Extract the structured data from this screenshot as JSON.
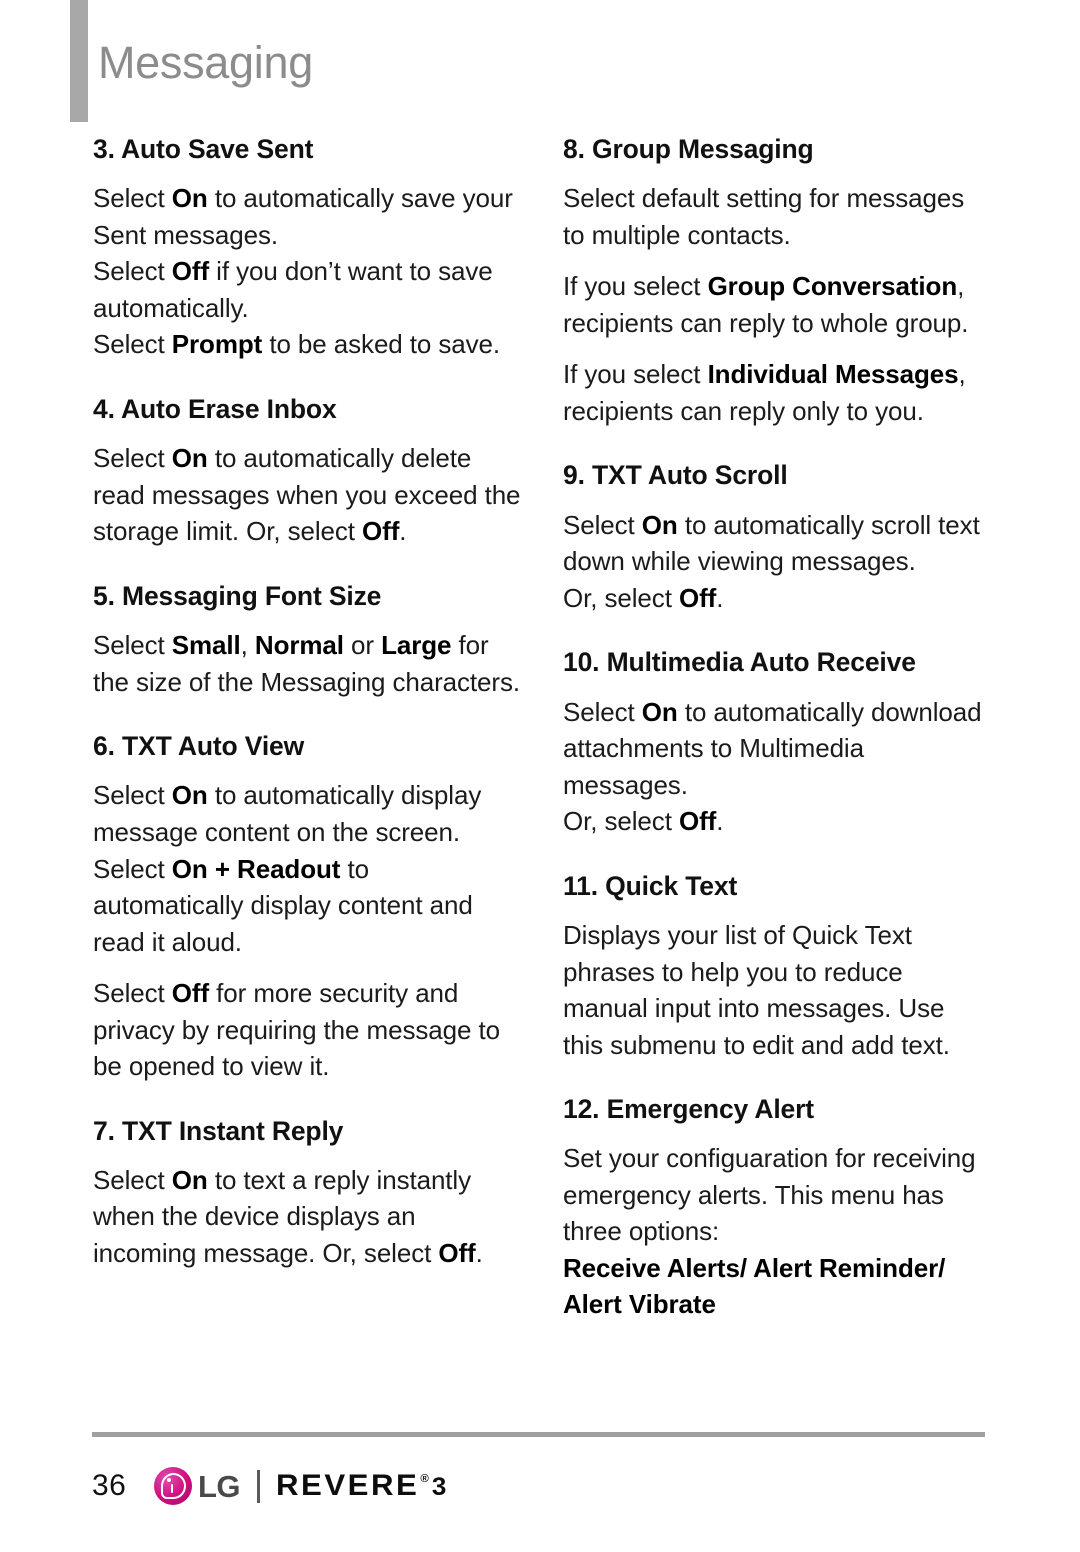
{
  "header": {
    "title": "Messaging"
  },
  "left_column": [
    {
      "type": "heading",
      "text": "3. Auto Save Sent"
    },
    {
      "type": "paragraph",
      "runs": [
        {
          "t": "Select ",
          "b": false
        },
        {
          "t": "On",
          "b": true
        },
        {
          "t": " to automatically save your Sent messages.",
          "b": false
        },
        {
          "t": "\n",
          "b": false
        },
        {
          "t": "Select ",
          "b": false
        },
        {
          "t": "Off",
          "b": true
        },
        {
          "t": " if you don’t want to save automatically.",
          "b": false
        },
        {
          "t": "\n",
          "b": false
        },
        {
          "t": "Select ",
          "b": false
        },
        {
          "t": "Prompt",
          "b": true
        },
        {
          "t": " to be asked to save.",
          "b": false
        }
      ]
    },
    {
      "type": "heading",
      "text": "4. Auto Erase Inbox"
    },
    {
      "type": "paragraph",
      "runs": [
        {
          "t": "Select ",
          "b": false
        },
        {
          "t": "On",
          "b": true
        },
        {
          "t": " to automatically delete read messages when you exceed the storage limit. Or, select ",
          "b": false
        },
        {
          "t": "Off",
          "b": true
        },
        {
          "t": ".",
          "b": false
        }
      ]
    },
    {
      "type": "heading",
      "text": "5. Messaging Font Size"
    },
    {
      "type": "paragraph",
      "runs": [
        {
          "t": "Select ",
          "b": false
        },
        {
          "t": "Small",
          "b": true
        },
        {
          "t": ", ",
          "b": false
        },
        {
          "t": "Normal",
          "b": true
        },
        {
          "t": " or ",
          "b": false
        },
        {
          "t": "Large",
          "b": true
        },
        {
          "t": " for the size of the Messaging characters.",
          "b": false
        }
      ]
    },
    {
      "type": "heading",
      "text": "6. TXT Auto View"
    },
    {
      "type": "paragraph",
      "runs": [
        {
          "t": "Select ",
          "b": false
        },
        {
          "t": "On",
          "b": true
        },
        {
          "t": " to automatically display message content on the screen.",
          "b": false
        },
        {
          "t": "\n",
          "b": false
        },
        {
          "t": "Select ",
          "b": false
        },
        {
          "t": "On + Readout",
          "b": true
        },
        {
          "t": " to automatically display content and read it aloud.",
          "b": false
        }
      ]
    },
    {
      "type": "paragraph",
      "runs": [
        {
          "t": "Select ",
          "b": false
        },
        {
          "t": "Off",
          "b": true
        },
        {
          "t": " for more security and privacy by requiring the message to be opened to view it.",
          "b": false
        }
      ]
    },
    {
      "type": "heading",
      "text": "7. TXT Instant Reply"
    },
    {
      "type": "paragraph",
      "runs": [
        {
          "t": "Select ",
          "b": false
        },
        {
          "t": "On",
          "b": true
        },
        {
          "t": " to text a reply instantly when the device displays an incoming message. Or, select ",
          "b": false
        },
        {
          "t": "Off",
          "b": true
        },
        {
          "t": ".",
          "b": false
        }
      ]
    }
  ],
  "right_column": [
    {
      "type": "heading",
      "text": "8. Group Messaging"
    },
    {
      "type": "paragraph",
      "runs": [
        {
          "t": "Select default setting for messages to multiple contacts.",
          "b": false
        }
      ]
    },
    {
      "type": "paragraph",
      "runs": [
        {
          "t": "If you select ",
          "b": false
        },
        {
          "t": "Group Conversation",
          "b": true
        },
        {
          "t": ", recipients can reply to whole group.",
          "b": false
        }
      ]
    },
    {
      "type": "paragraph",
      "runs": [
        {
          "t": "If you select ",
          "b": false
        },
        {
          "t": "Individual Messages",
          "b": true
        },
        {
          "t": ", recipients can reply only to you.",
          "b": false
        }
      ]
    },
    {
      "type": "heading",
      "text": "9. TXT Auto Scroll"
    },
    {
      "type": "paragraph",
      "runs": [
        {
          "t": "Select ",
          "b": false
        },
        {
          "t": "On",
          "b": true
        },
        {
          "t": " to automatically scroll text down while viewing messages.",
          "b": false
        },
        {
          "t": "\n",
          "b": false
        },
        {
          "t": "Or, select ",
          "b": false
        },
        {
          "t": "Off",
          "b": true
        },
        {
          "t": ".",
          "b": false
        }
      ]
    },
    {
      "type": "heading",
      "text": "10. Multimedia Auto Receive"
    },
    {
      "type": "paragraph",
      "runs": [
        {
          "t": "Select ",
          "b": false
        },
        {
          "t": "On",
          "b": true
        },
        {
          "t": " to automatically download attachments to Multimedia messages.",
          "b": false
        },
        {
          "t": "\n",
          "b": false
        },
        {
          "t": "Or, select ",
          "b": false
        },
        {
          "t": "Off",
          "b": true
        },
        {
          "t": ".",
          "b": false
        }
      ]
    },
    {
      "type": "heading",
      "text": "11. Quick Text"
    },
    {
      "type": "paragraph",
      "runs": [
        {
          "t": "Displays your list of Quick Text phrases to help you to reduce manual input into messages. Use this submenu to edit and add text.",
          "b": false
        }
      ]
    },
    {
      "type": "heading",
      "text": "12. Emergency Alert"
    },
    {
      "type": "paragraph",
      "runs": [
        {
          "t": "Set your configuaration for receiving emergency alerts. This menu has three options:",
          "b": false
        },
        {
          "t": "\n",
          "b": false
        },
        {
          "t": "Receive Alerts/ Alert Reminder/ Alert Vibrate",
          "b": true
        }
      ]
    }
  ],
  "footer": {
    "page_number": "36",
    "lg_wordmark": "LG",
    "product_name": "REVERE",
    "registered_mark": "®",
    "generation": "3",
    "brand_color": "#cf127f",
    "rule_color": "#a0a0a0"
  }
}
